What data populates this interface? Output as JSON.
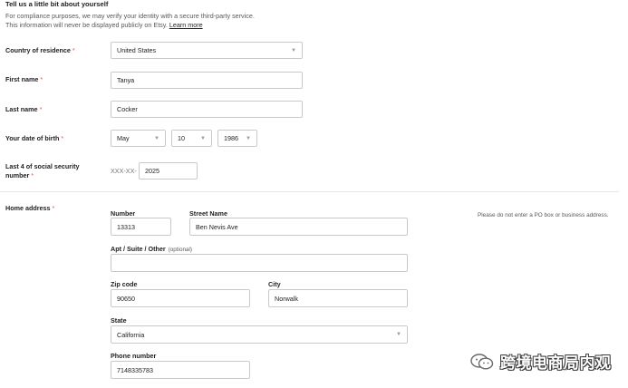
{
  "header": {
    "title": "Tell us a little bit about yourself",
    "intro_line1": "For compliance purposes, we may verify your identity with a secure third-party service.",
    "intro_line2": "This information will never be displayed publicly on Etsy.",
    "learn_more": "Learn more"
  },
  "required_marker": "*",
  "country": {
    "label": "Country of residence",
    "value": "United States"
  },
  "first_name": {
    "label": "First name",
    "value": "Tanya"
  },
  "last_name": {
    "label": "Last name",
    "value": "Cocker"
  },
  "dob": {
    "label": "Your date of birth",
    "month": "May",
    "day": "10",
    "year": "1986"
  },
  "ssn": {
    "label_line1": "Last 4 of social security",
    "label_line2": "number",
    "prefix": "XXX-XX-",
    "value": "2025"
  },
  "address": {
    "label": "Home address",
    "number_label": "Number",
    "number_value": "13313",
    "street_label": "Street Name",
    "street_value": "Ben Nevis Ave",
    "street_hint": "Please do not enter a PO box or business address.",
    "apt_label": "Apt / Suite / Other",
    "apt_optional": "(optional)",
    "apt_value": "",
    "zip_label": "Zip code",
    "zip_value": "90650",
    "city_label": "City",
    "city_value": "Norwalk",
    "state_label": "State",
    "state_value": "California",
    "phone_label": "Phone number",
    "phone_value": "7148335783"
  },
  "watermark": {
    "text": "跨境电商局内观",
    "icon": "wechat-icon"
  },
  "icons": {
    "caret": "chevron-down-icon"
  },
  "colors": {
    "required": "#e55a3a",
    "border": "#c9c9c9"
  }
}
